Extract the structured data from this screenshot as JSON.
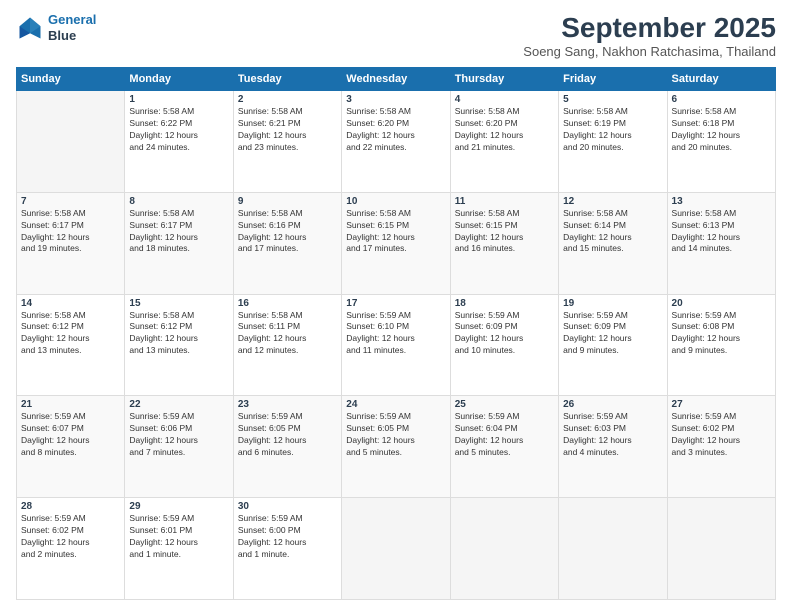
{
  "logo": {
    "line1": "General",
    "line2": "Blue"
  },
  "header": {
    "title": "September 2025",
    "subtitle": "Soeng Sang, Nakhon Ratchasima, Thailand"
  },
  "weekdays": [
    "Sunday",
    "Monday",
    "Tuesday",
    "Wednesday",
    "Thursday",
    "Friday",
    "Saturday"
  ],
  "weeks": [
    [
      {
        "day": "",
        "info": ""
      },
      {
        "day": "1",
        "info": "Sunrise: 5:58 AM\nSunset: 6:22 PM\nDaylight: 12 hours\nand 24 minutes."
      },
      {
        "day": "2",
        "info": "Sunrise: 5:58 AM\nSunset: 6:21 PM\nDaylight: 12 hours\nand 23 minutes."
      },
      {
        "day": "3",
        "info": "Sunrise: 5:58 AM\nSunset: 6:20 PM\nDaylight: 12 hours\nand 22 minutes."
      },
      {
        "day": "4",
        "info": "Sunrise: 5:58 AM\nSunset: 6:20 PM\nDaylight: 12 hours\nand 21 minutes."
      },
      {
        "day": "5",
        "info": "Sunrise: 5:58 AM\nSunset: 6:19 PM\nDaylight: 12 hours\nand 20 minutes."
      },
      {
        "day": "6",
        "info": "Sunrise: 5:58 AM\nSunset: 6:18 PM\nDaylight: 12 hours\nand 20 minutes."
      }
    ],
    [
      {
        "day": "7",
        "info": "Sunrise: 5:58 AM\nSunset: 6:17 PM\nDaylight: 12 hours\nand 19 minutes."
      },
      {
        "day": "8",
        "info": "Sunrise: 5:58 AM\nSunset: 6:17 PM\nDaylight: 12 hours\nand 18 minutes."
      },
      {
        "day": "9",
        "info": "Sunrise: 5:58 AM\nSunset: 6:16 PM\nDaylight: 12 hours\nand 17 minutes."
      },
      {
        "day": "10",
        "info": "Sunrise: 5:58 AM\nSunset: 6:15 PM\nDaylight: 12 hours\nand 17 minutes."
      },
      {
        "day": "11",
        "info": "Sunrise: 5:58 AM\nSunset: 6:15 PM\nDaylight: 12 hours\nand 16 minutes."
      },
      {
        "day": "12",
        "info": "Sunrise: 5:58 AM\nSunset: 6:14 PM\nDaylight: 12 hours\nand 15 minutes."
      },
      {
        "day": "13",
        "info": "Sunrise: 5:58 AM\nSunset: 6:13 PM\nDaylight: 12 hours\nand 14 minutes."
      }
    ],
    [
      {
        "day": "14",
        "info": "Sunrise: 5:58 AM\nSunset: 6:12 PM\nDaylight: 12 hours\nand 13 minutes."
      },
      {
        "day": "15",
        "info": "Sunrise: 5:58 AM\nSunset: 6:12 PM\nDaylight: 12 hours\nand 13 minutes."
      },
      {
        "day": "16",
        "info": "Sunrise: 5:58 AM\nSunset: 6:11 PM\nDaylight: 12 hours\nand 12 minutes."
      },
      {
        "day": "17",
        "info": "Sunrise: 5:59 AM\nSunset: 6:10 PM\nDaylight: 12 hours\nand 11 minutes."
      },
      {
        "day": "18",
        "info": "Sunrise: 5:59 AM\nSunset: 6:09 PM\nDaylight: 12 hours\nand 10 minutes."
      },
      {
        "day": "19",
        "info": "Sunrise: 5:59 AM\nSunset: 6:09 PM\nDaylight: 12 hours\nand 9 minutes."
      },
      {
        "day": "20",
        "info": "Sunrise: 5:59 AM\nSunset: 6:08 PM\nDaylight: 12 hours\nand 9 minutes."
      }
    ],
    [
      {
        "day": "21",
        "info": "Sunrise: 5:59 AM\nSunset: 6:07 PM\nDaylight: 12 hours\nand 8 minutes."
      },
      {
        "day": "22",
        "info": "Sunrise: 5:59 AM\nSunset: 6:06 PM\nDaylight: 12 hours\nand 7 minutes."
      },
      {
        "day": "23",
        "info": "Sunrise: 5:59 AM\nSunset: 6:05 PM\nDaylight: 12 hours\nand 6 minutes."
      },
      {
        "day": "24",
        "info": "Sunrise: 5:59 AM\nSunset: 6:05 PM\nDaylight: 12 hours\nand 5 minutes."
      },
      {
        "day": "25",
        "info": "Sunrise: 5:59 AM\nSunset: 6:04 PM\nDaylight: 12 hours\nand 5 minutes."
      },
      {
        "day": "26",
        "info": "Sunrise: 5:59 AM\nSunset: 6:03 PM\nDaylight: 12 hours\nand 4 minutes."
      },
      {
        "day": "27",
        "info": "Sunrise: 5:59 AM\nSunset: 6:02 PM\nDaylight: 12 hours\nand 3 minutes."
      }
    ],
    [
      {
        "day": "28",
        "info": "Sunrise: 5:59 AM\nSunset: 6:02 PM\nDaylight: 12 hours\nand 2 minutes."
      },
      {
        "day": "29",
        "info": "Sunrise: 5:59 AM\nSunset: 6:01 PM\nDaylight: 12 hours\nand 1 minute."
      },
      {
        "day": "30",
        "info": "Sunrise: 5:59 AM\nSunset: 6:00 PM\nDaylight: 12 hours\nand 1 minute."
      },
      {
        "day": "",
        "info": ""
      },
      {
        "day": "",
        "info": ""
      },
      {
        "day": "",
        "info": ""
      },
      {
        "day": "",
        "info": ""
      }
    ]
  ]
}
